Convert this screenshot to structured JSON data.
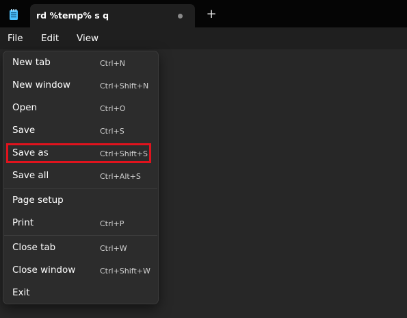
{
  "window": {
    "tab_title": "rd %temp% s q",
    "app_icon": "notepad-icon",
    "tab_status_icon": "unsaved-dot-icon",
    "new_tab_label": "+"
  },
  "menubar": {
    "items": [
      "File",
      "Edit",
      "View"
    ]
  },
  "file_menu": {
    "items": [
      {
        "label": "New tab",
        "shortcut": "Ctrl+N"
      },
      {
        "label": "New window",
        "shortcut": "Ctrl+Shift+N"
      },
      {
        "label": "Open",
        "shortcut": "Ctrl+O"
      },
      {
        "label": "Save",
        "shortcut": "Ctrl+S"
      },
      {
        "label": "Save as",
        "shortcut": "Ctrl+Shift+S",
        "highlighted": true
      },
      {
        "label": "Save all",
        "shortcut": "Ctrl+Alt+S"
      },
      {
        "label": "Page setup",
        "shortcut": ""
      },
      {
        "label": "Print",
        "shortcut": "Ctrl+P"
      },
      {
        "label": "Close tab",
        "shortcut": "Ctrl+W"
      },
      {
        "label": "Close window",
        "shortcut": "Ctrl+Shift+W"
      },
      {
        "label": "Exit",
        "shortcut": ""
      }
    ]
  },
  "colors": {
    "titlebar_bg": "#050505",
    "menu_bg": "#2c2c2c",
    "editor_bg": "#272727",
    "highlight_border": "#e0131d"
  }
}
